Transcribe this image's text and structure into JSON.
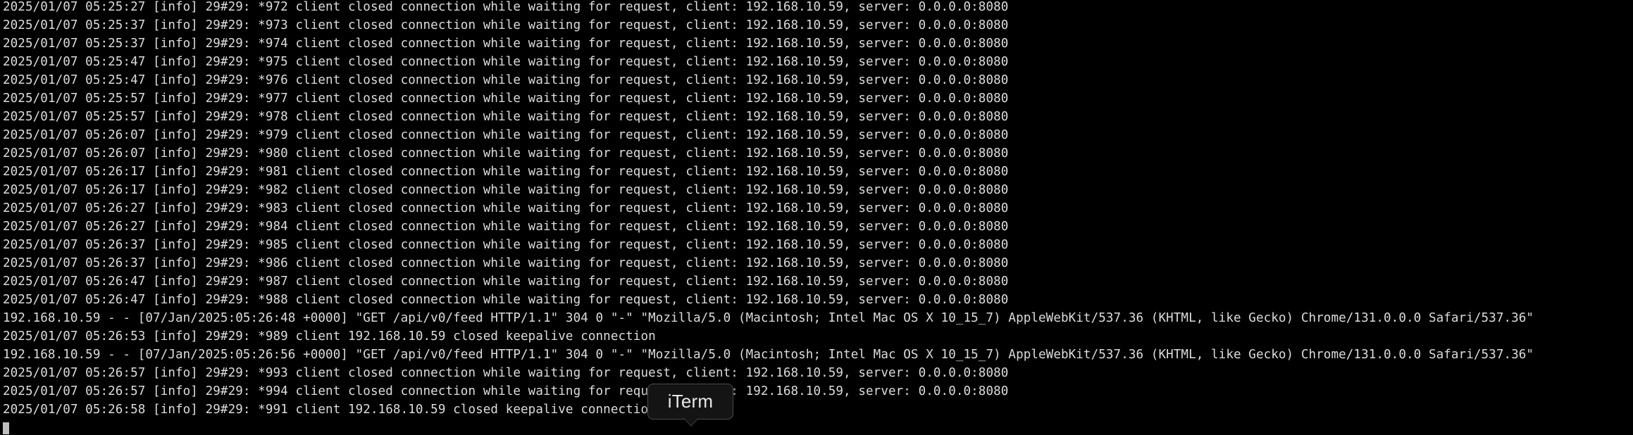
{
  "terminal": {
    "lines": [
      "2025/01/07 05:25:27 [info] 29#29: *972 client closed connection while waiting for request, client: 192.168.10.59, server: 0.0.0.0:8080",
      "2025/01/07 05:25:37 [info] 29#29: *973 client closed connection while waiting for request, client: 192.168.10.59, server: 0.0.0.0:8080",
      "2025/01/07 05:25:37 [info] 29#29: *974 client closed connection while waiting for request, client: 192.168.10.59, server: 0.0.0.0:8080",
      "2025/01/07 05:25:47 [info] 29#29: *975 client closed connection while waiting for request, client: 192.168.10.59, server: 0.0.0.0:8080",
      "2025/01/07 05:25:47 [info] 29#29: *976 client closed connection while waiting for request, client: 192.168.10.59, server: 0.0.0.0:8080",
      "2025/01/07 05:25:57 [info] 29#29: *977 client closed connection while waiting for request, client: 192.168.10.59, server: 0.0.0.0:8080",
      "2025/01/07 05:25:57 [info] 29#29: *978 client closed connection while waiting for request, client: 192.168.10.59, server: 0.0.0.0:8080",
      "2025/01/07 05:26:07 [info] 29#29: *979 client closed connection while waiting for request, client: 192.168.10.59, server: 0.0.0.0:8080",
      "2025/01/07 05:26:07 [info] 29#29: *980 client closed connection while waiting for request, client: 192.168.10.59, server: 0.0.0.0:8080",
      "2025/01/07 05:26:17 [info] 29#29: *981 client closed connection while waiting for request, client: 192.168.10.59, server: 0.0.0.0:8080",
      "2025/01/07 05:26:17 [info] 29#29: *982 client closed connection while waiting for request, client: 192.168.10.59, server: 0.0.0.0:8080",
      "2025/01/07 05:26:27 [info] 29#29: *983 client closed connection while waiting for request, client: 192.168.10.59, server: 0.0.0.0:8080",
      "2025/01/07 05:26:27 [info] 29#29: *984 client closed connection while waiting for request, client: 192.168.10.59, server: 0.0.0.0:8080",
      "2025/01/07 05:26:37 [info] 29#29: *985 client closed connection while waiting for request, client: 192.168.10.59, server: 0.0.0.0:8080",
      "2025/01/07 05:26:37 [info] 29#29: *986 client closed connection while waiting for request, client: 192.168.10.59, server: 0.0.0.0:8080",
      "2025/01/07 05:26:47 [info] 29#29: *987 client closed connection while waiting for request, client: 192.168.10.59, server: 0.0.0.0:8080",
      "2025/01/07 05:26:47 [info] 29#29: *988 client closed connection while waiting for request, client: 192.168.10.59, server: 0.0.0.0:8080",
      "192.168.10.59 - - [07/Jan/2025:05:26:48 +0000] \"GET /api/v0/feed HTTP/1.1\" 304 0 \"-\" \"Mozilla/5.0 (Macintosh; Intel Mac OS X 10_15_7) AppleWebKit/537.36 (KHTML, like Gecko) Chrome/131.0.0.0 Safari/537.36\"",
      "2025/01/07 05:26:53 [info] 29#29: *989 client 192.168.10.59 closed keepalive connection",
      "192.168.10.59 - - [07/Jan/2025:05:26:56 +0000] \"GET /api/v0/feed HTTP/1.1\" 304 0 \"-\" \"Mozilla/5.0 (Macintosh; Intel Mac OS X 10_15_7) AppleWebKit/537.36 (KHTML, like Gecko) Chrome/131.0.0.0 Safari/537.36\"",
      "2025/01/07 05:26:57 [info] 29#29: *993 client closed connection while waiting for request, client: 192.168.10.59, server: 0.0.0.0:8080",
      "2025/01/07 05:26:57 [info] 29#29: *994 client closed connection while waiting for request, client: 192.168.10.59, server: 0.0.0.0:8080",
      "2025/01/07 05:26:58 [info] 29#29: *991 client 192.168.10.59 closed keepalive connection"
    ]
  },
  "tooltip": {
    "label": "iTerm"
  },
  "colors": {
    "background": "#000000",
    "text": "#dcdcdc",
    "cursor": "#bfbfbf",
    "tooltip_background": "#141414",
    "tooltip_border": "#4a4a4a"
  }
}
